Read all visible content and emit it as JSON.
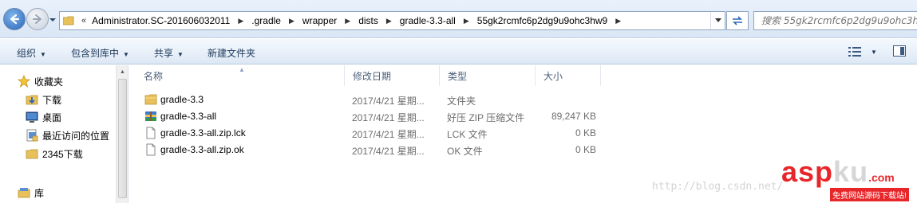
{
  "address_bar": {
    "overflow_chevron": "«",
    "crumbs": [
      "Administrator.SC-201606032011",
      ".gradle",
      "wrapper",
      "dists",
      "gradle-3.3-all",
      "55gk2rcmfc6p2dg9u9ohc3hw9"
    ],
    "search_placeholder": "搜索 55gk2rcmfc6p2dg9u9ohc3hw9"
  },
  "toolbar": {
    "organize": "组织",
    "include_in_library": "包含到库中",
    "share": "共享",
    "new_folder": "新建文件夹"
  },
  "nav": {
    "favorites": "收藏夹",
    "downloads": "下载",
    "desktop": "桌面",
    "recent_places": "最近访问的位置",
    "downloads_2345": "2345下载",
    "libraries": "库"
  },
  "columns": {
    "name": "名称",
    "date": "修改日期",
    "type": "类型",
    "size": "大小"
  },
  "files": [
    {
      "name": "gradle-3.3",
      "date": "2017/4/21 星期...",
      "type": "文件夹",
      "size": "",
      "icon": "folder-icon"
    },
    {
      "name": "gradle-3.3-all",
      "date": "2017/4/21 星期...",
      "type": "好压 ZIP 压缩文件",
      "size": "89,247 KB",
      "icon": "zip-archive-icon"
    },
    {
      "name": "gradle-3.3-all.zip.lck",
      "date": "2017/4/21 星期...",
      "type": "LCK 文件",
      "size": "0 KB",
      "icon": "file-icon"
    },
    {
      "name": "gradle-3.3-all.zip.ok",
      "date": "2017/4/21 星期...",
      "type": "OK 文件",
      "size": "0 KB",
      "icon": "file-icon"
    }
  ],
  "watermark": {
    "url": "http://blog.csdn.net/",
    "logo_a": "asp",
    "logo_b": "ku",
    "logo_c": ".com",
    "tagline": "免费网站源码下载站!"
  },
  "colors": {
    "accent": "#2b66b8",
    "folder": "#e8c15a",
    "watermark_red": "#e8262a"
  }
}
